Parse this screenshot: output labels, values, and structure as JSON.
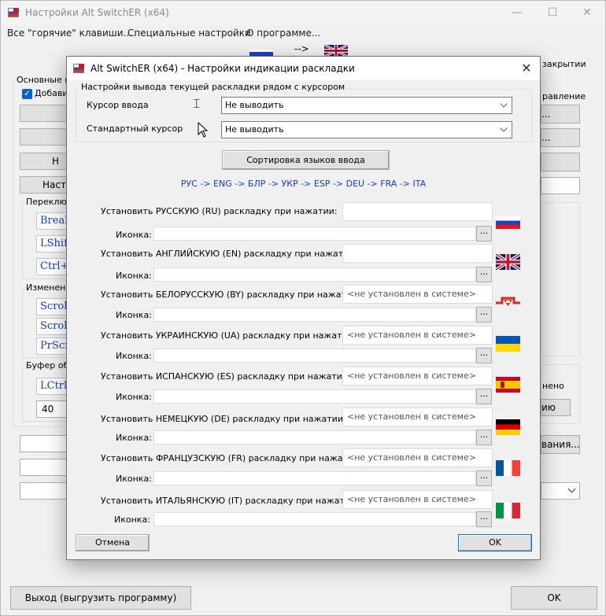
{
  "main_window": {
    "title": "Настройки Alt SwitchER (x64)",
    "menu": [
      "Все \"горячие\" клавиши...",
      "Специальные настройки",
      "О программе..."
    ],
    "arrow": "-->",
    "group_main_label": "Основные на",
    "checkbox_label": "Добавит",
    "button_partial_1": "Н",
    "button_partial_2": "Настр",
    "group_switch_label": "Переключ",
    "group_change_label": "Изменени",
    "group_buffer_label": "Буфер обм",
    "switch_items": [
      "Break",
      "LShif",
      "Ctrl+"
    ],
    "change_items": [
      "Scrol",
      "Scrol",
      "PrScr"
    ],
    "buffer_item": "LCtrl-",
    "buffer_value": "40",
    "right_text_close": "закрытии",
    "right_text_manage": "равление",
    "right_text_change": "нено",
    "right_btn_dots1": "...",
    "right_btn_dots2": "...",
    "right_btn_partial": "ию",
    "right_btn_tions": "вания...",
    "exit_button": "Выход (выгрузить программу)",
    "ok_button": "OK"
  },
  "dialog": {
    "title": "Alt SwitchER (x64) - Настройки индикации раскладки",
    "group_label": "Настройки вывода текущей раскладки рядом с курсором",
    "input_cursor_label": "Курсор ввода",
    "input_cursor_value": "Не выводить",
    "std_cursor_label": "Стандартный курсор",
    "std_cursor_value": "Не выводить",
    "sort_button": "Сортировка языков ввода",
    "order": "РУС -> ENG -> БЛР -> УКР -> ESP -> DEU -> FRA -> ITA",
    "icon_label": "Иконка:",
    "dots": "...",
    "rows": [
      {
        "label": "Установить РУССКУЮ (RU) раскладку при нажатии:",
        "value": "",
        "flag": "ru"
      },
      {
        "label": "Установить АНГЛИЙСКУЮ (EN) раскладку при нажатии:",
        "value": "",
        "flag": "en"
      },
      {
        "label": "Установить БЕЛОРУССКУЮ (BY) раскладку при нажатии:",
        "value": "<не установлен в системе>",
        "flag": "by"
      },
      {
        "label": "Установить УКРАИНСКУЮ (UA) раскладку при нажатии:",
        "value": "<не установлен в системе>",
        "flag": "ua"
      },
      {
        "label": "Установить ИСПАНСКУЮ (ES) раскладку при нажатии:",
        "value": "<не установлен в системе>",
        "flag": "es"
      },
      {
        "label": "Установить НЕМЕЦКУЮ (DE) раскладку при нажатии:",
        "value": "<не установлен в системе>",
        "flag": "de"
      },
      {
        "label": "Установить ФРАНЦУЗСКУЮ (FR) раскладку при нажатии:",
        "value": "<не установлен в системе>",
        "flag": "fr"
      },
      {
        "label": "Установить ИТАЛЬЯНСКУЮ (IT) раскладку при нажатии:",
        "value": "<не установлен в системе>",
        "flag": "it"
      }
    ],
    "cancel_button": "Отмена",
    "ok_button": "OK"
  }
}
